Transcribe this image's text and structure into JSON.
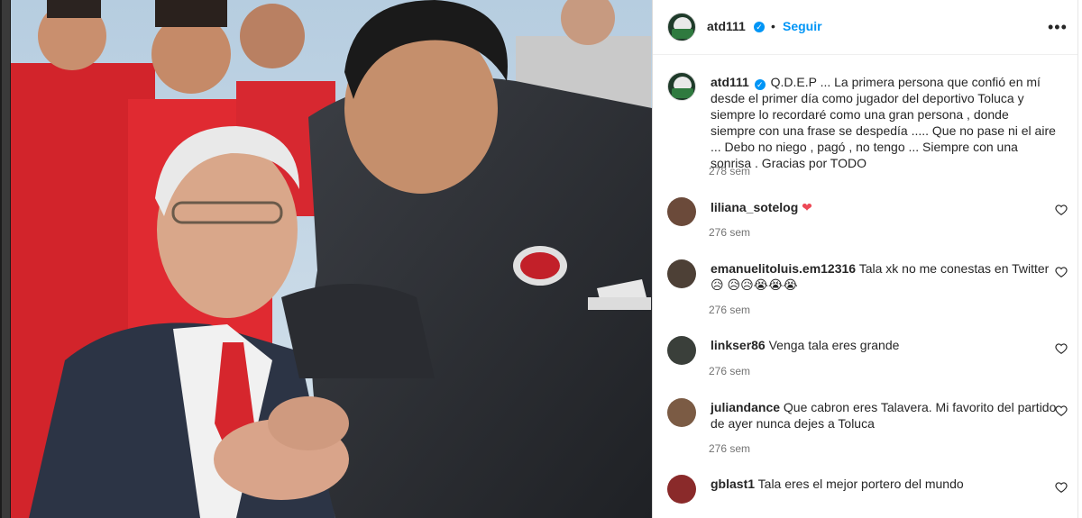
{
  "post": {
    "author": "atd111",
    "follow_label": "Seguir",
    "separator": "•",
    "more_label": "•••",
    "caption": "Q.D.E.P ... La primera persona que confió en mí desde el primer día como jugador del deportivo Toluca y siempre lo recordaré como una gran persona , donde siempre con una frase se despedía ..... Que no pase ni el aire ... Debo no niego , pagó , no tengo ... Siempre con una sonrisa . Gracias por TODO",
    "caption_age": "278 sem"
  },
  "comments": [
    {
      "user": "liliana_sotelog",
      "text": "",
      "emoji": "❤",
      "age": "276 sem",
      "avatar_color": "#6b4a3a"
    },
    {
      "user": "emanuelitoluis.em12316",
      "text": "Tala xk no me conestas en Twitter",
      "emoji": "😥 😥😥😭😭😭",
      "age": "276 sem",
      "avatar_color": "#4d4036"
    },
    {
      "user": "linkser86",
      "text": "Venga tala eres grande",
      "age": "276 sem",
      "avatar_color": "#3a3f3a"
    },
    {
      "user": "juliandance",
      "text": "Que cabron eres Talavera. Mi favorito del partido de ayer nunca dejes a Toluca",
      "age": "276 sem",
      "avatar_color": "#7b5b44"
    },
    {
      "user": "gblast1",
      "text": "Tala eres el mejor portero del mundo",
      "age": "",
      "avatar_color": "#8a2a2a"
    }
  ],
  "colors": {
    "accent": "#0095f6",
    "text": "#262626",
    "muted": "#737373",
    "heart": "#ed4956"
  },
  "icons": [
    "verified-icon",
    "more-options-icon",
    "heart-outline-icon"
  ],
  "photo": {
    "description_icon": "post-image"
  }
}
